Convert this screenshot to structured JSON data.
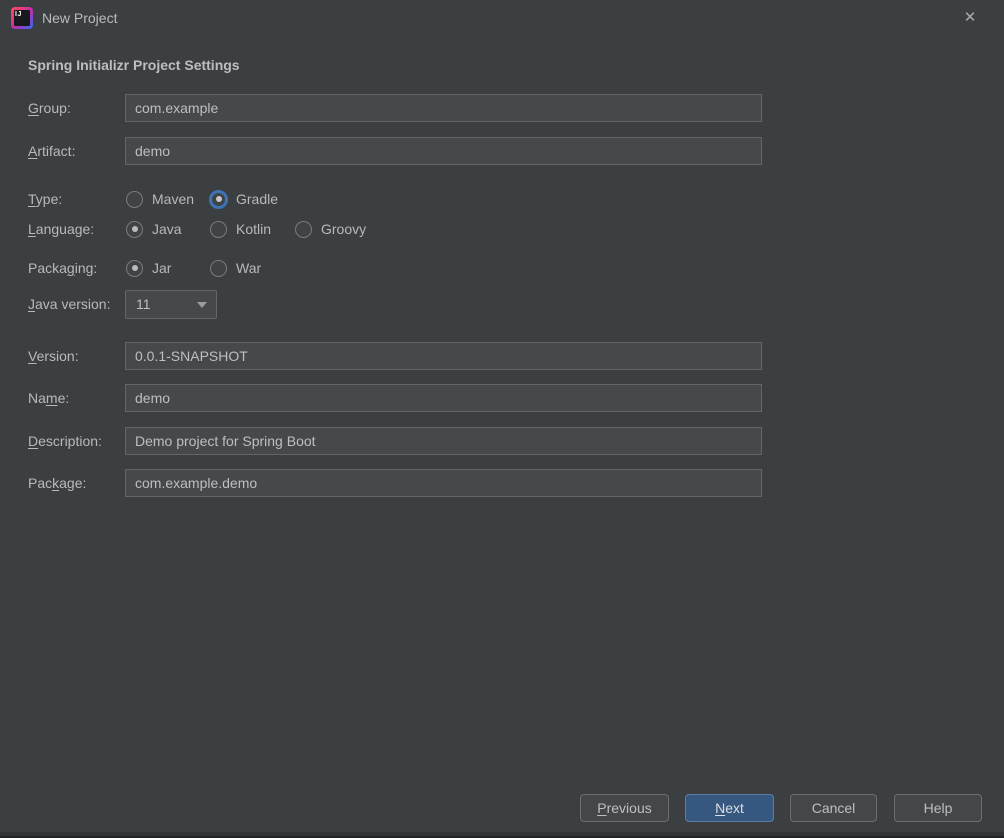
{
  "window": {
    "title": "New Project",
    "app_icon_text": "IJ",
    "close_glyph": "✕"
  },
  "header": {
    "title": "Spring Initializr Project Settings"
  },
  "form": {
    "group": {
      "label": "Group:",
      "mnemonic": "G",
      "value": "com.example"
    },
    "artifact": {
      "label": "Artifact:",
      "mnemonic": "A",
      "value": "demo"
    },
    "type": {
      "label": "Type:",
      "mnemonic": "T",
      "options": [
        {
          "label": "Maven",
          "selected": false
        },
        {
          "label": "Gradle",
          "selected": true,
          "focused": true
        }
      ]
    },
    "language": {
      "label": "Language:",
      "mnemonic": "L",
      "options": [
        {
          "label": "Java",
          "selected": true
        },
        {
          "label": "Kotlin",
          "selected": false
        },
        {
          "label": "Groovy",
          "selected": false
        }
      ]
    },
    "packaging": {
      "label": "Packaging:",
      "mnemonic": "g",
      "options": [
        {
          "label": "Jar",
          "selected": true
        },
        {
          "label": "War",
          "selected": false
        }
      ]
    },
    "java_version": {
      "label": "Java version:",
      "mnemonic": "J",
      "value": "11"
    },
    "version": {
      "label": "Version:",
      "mnemonic": "V",
      "value": "0.0.1-SNAPSHOT"
    },
    "name": {
      "label": "Name:",
      "mnemonic": "m",
      "value": "demo"
    },
    "description": {
      "label": "Description:",
      "mnemonic": "D",
      "value": "Demo project for Spring Boot"
    },
    "package": {
      "label": "Package:",
      "mnemonic": "k",
      "value": "com.example.demo"
    }
  },
  "buttons": {
    "previous": {
      "label": "Previous",
      "mnemonic": "P"
    },
    "next": {
      "label": "Next",
      "mnemonic": "N"
    },
    "cancel": {
      "label": "Cancel"
    },
    "help": {
      "label": "Help"
    }
  },
  "colors": {
    "dialog_bg": "#3c3f42",
    "field_bg": "#45494a",
    "field_border": "#626668",
    "text": "#bbbbbb",
    "default_button_bg": "#365880",
    "focus_ring_blue": "#3d74b8"
  }
}
